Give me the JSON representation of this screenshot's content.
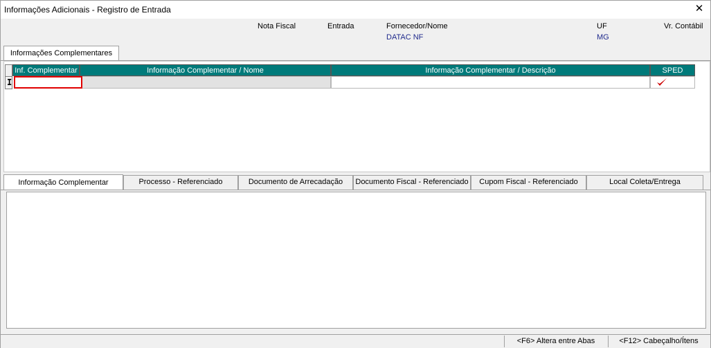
{
  "window": {
    "title": "Informações Adicionais - Registro de Entrada",
    "close_glyph": "✕"
  },
  "header": {
    "labels": {
      "nota_fiscal": "Nota Fiscal",
      "entrada": "Entrada",
      "fornecedor": "Fornecedor/Nome",
      "uf": "UF",
      "vr_contabil": "Vr. Contábil"
    },
    "values": {
      "fornecedor": "DATAC NF",
      "uf": "MG"
    }
  },
  "top_tab": {
    "label": "Informações Complementares"
  },
  "grid": {
    "columns": [
      "Inf. Complementar",
      "Informação Complementar / Nome",
      "Informação Complementar / Descrição",
      "SPED"
    ],
    "row_indicator": "I",
    "rows": [
      {
        "inf_complementar": "",
        "nome": "",
        "descricao": "",
        "sped_checked": true
      }
    ]
  },
  "bottom_tabs": [
    {
      "label": "Informação Complementar",
      "active": true
    },
    {
      "label": "Processo - Referenciado",
      "active": false
    },
    {
      "label": "Documento de Arrecadação",
      "active": false
    },
    {
      "label": "Documento Fiscal - Referenciado",
      "active": false
    },
    {
      "label": "Cupom Fiscal - Referenciado",
      "active": false
    },
    {
      "label": "Local Coleta/Entrega",
      "active": false
    }
  ],
  "statusbar": {
    "f6": "<F6> Altera entre Abas",
    "f12": "<F12> Cabeçalho/Ítens"
  },
  "colors": {
    "header_teal": "#007a7a",
    "value_blue": "#1f2a8c",
    "editor_border": "#e00000",
    "check_red": "#cc0000"
  }
}
